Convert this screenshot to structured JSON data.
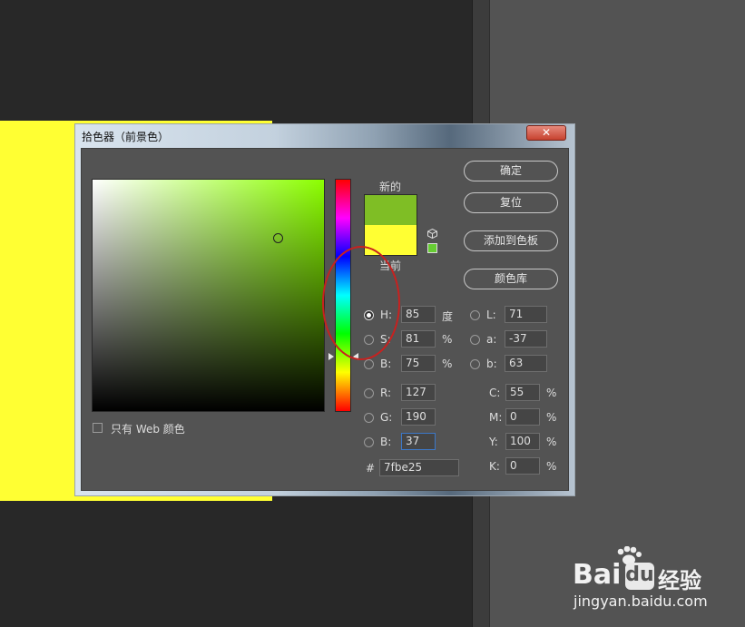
{
  "dialog": {
    "title": "拾色器（前景色）",
    "close_symbol": "✕"
  },
  "swatches": {
    "new_label": "新的",
    "current_label": "当前",
    "new_color": "#7fbe25",
    "current_color": "#ffff33"
  },
  "buttons": {
    "ok": "确定",
    "reset": "复位",
    "add_to_swatches": "添加到色板",
    "color_libraries": "颜色库"
  },
  "hsb": [
    {
      "label": "H:",
      "value": "85",
      "unit": "度",
      "selected": true
    },
    {
      "label": "S:",
      "value": "81",
      "unit": "%",
      "selected": false
    },
    {
      "label": "B:",
      "value": "75",
      "unit": "%",
      "selected": false
    }
  ],
  "rgb": [
    {
      "label": "R:",
      "value": "127"
    },
    {
      "label": "G:",
      "value": "190"
    },
    {
      "label": "B:",
      "value": "37"
    }
  ],
  "lab": [
    {
      "label": "L:",
      "value": "71"
    },
    {
      "label": "a:",
      "value": "-37"
    },
    {
      "label": "b:",
      "value": "63"
    }
  ],
  "cmyk": [
    {
      "label": "C:",
      "value": "55",
      "unit": "%"
    },
    {
      "label": "M:",
      "value": "0",
      "unit": "%"
    },
    {
      "label": "Y:",
      "value": "100",
      "unit": "%"
    },
    {
      "label": "K:",
      "value": "0",
      "unit": "%"
    }
  ],
  "hex": {
    "label": "#",
    "value": "7fbe25"
  },
  "web_only": {
    "label": "只有 Web 颜色",
    "checked": false
  },
  "colors": {
    "canvas": "#ffff33",
    "hue_base": "#8cff00",
    "annotation": "#c8211f"
  },
  "watermark": {
    "brand_left": "Bai",
    "brand_right": "du",
    "brand_cn": "经验",
    "url": "jingyan.baidu.com"
  }
}
